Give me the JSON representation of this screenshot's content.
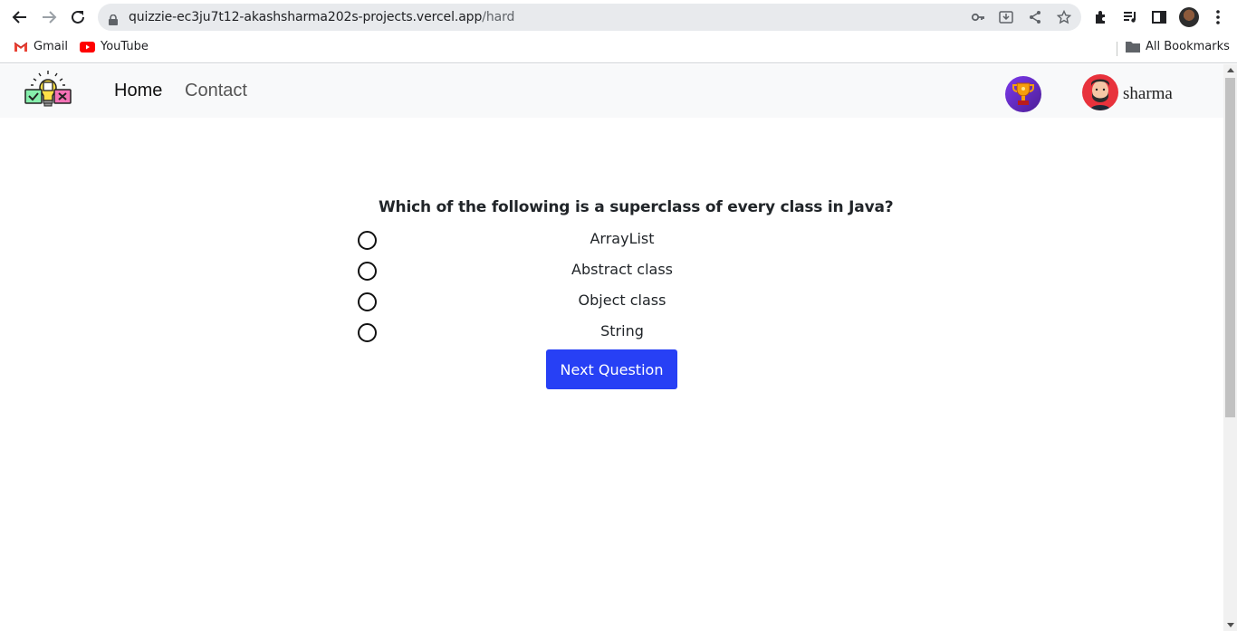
{
  "browser": {
    "url_host": "quizzie-ec3ju7t12-akashsharma202s-projects.vercel.app",
    "url_path": "/hard",
    "bookmarks": [
      {
        "label": "Gmail",
        "icon": "gmail-icon"
      },
      {
        "label": "YouTube",
        "icon": "youtube-icon"
      }
    ],
    "all_bookmarks_label": "All Bookmarks"
  },
  "nav": {
    "links": [
      {
        "label": "Home"
      },
      {
        "label": "Contact"
      }
    ],
    "username": "sharma"
  },
  "quiz": {
    "question": "Which of the following is a superclass of every class in Java?",
    "options": [
      {
        "label": "ArrayList"
      },
      {
        "label": "Abstract class"
      },
      {
        "label": "Object class"
      },
      {
        "label": "String"
      }
    ],
    "next_label": "Next Question"
  },
  "colors": {
    "primary_button": "#2740f5",
    "navbar_bg": "#f8f9fa"
  }
}
